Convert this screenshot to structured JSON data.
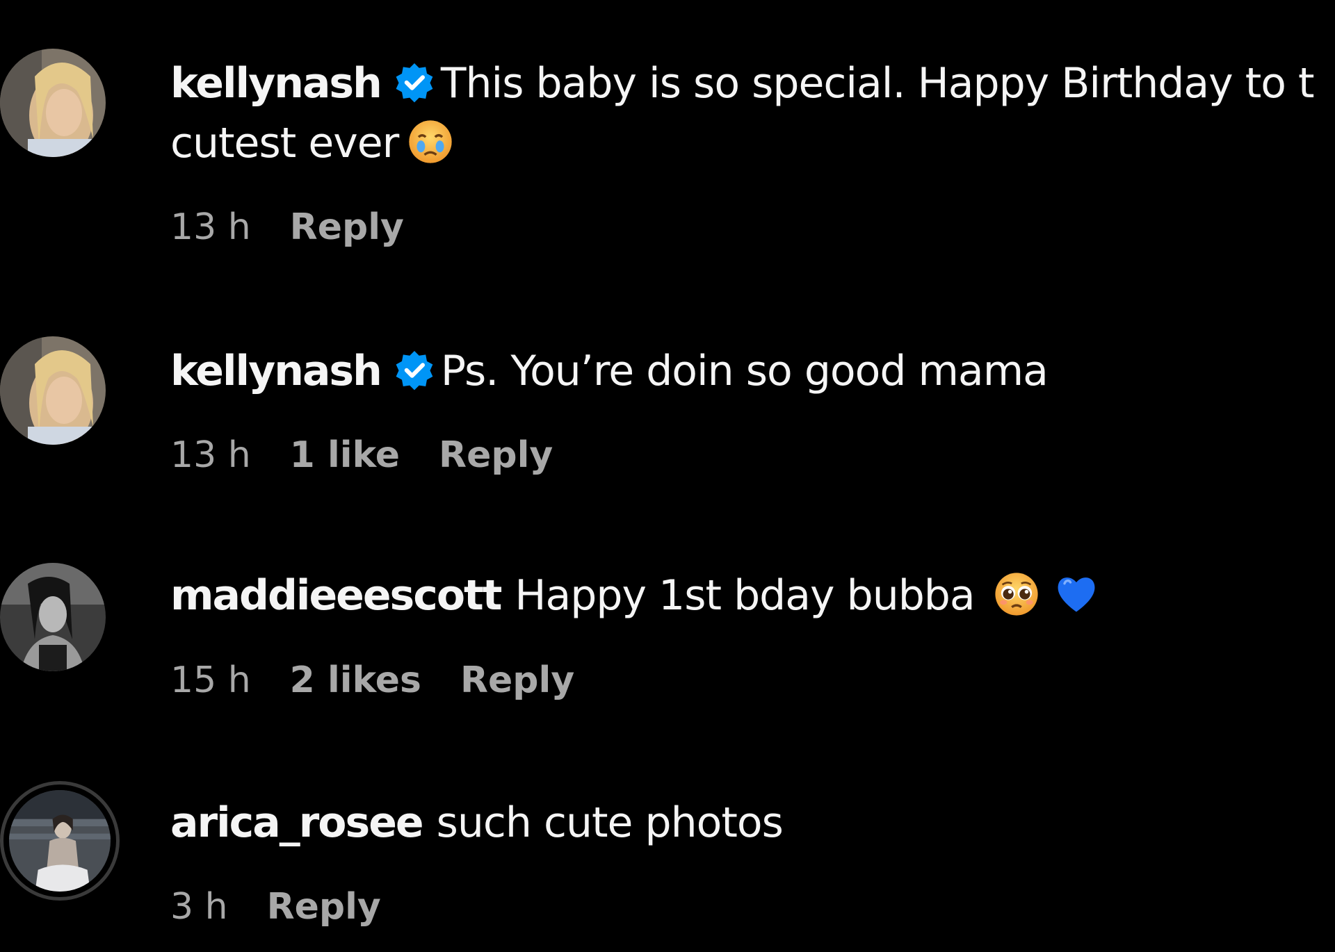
{
  "comments": [
    {
      "username": "kellynash",
      "verified": true,
      "text": "This baby is so special. Happy Birthday to t",
      "text_line2": "cutest ever",
      "emoji": "crying-face-icon",
      "time": "13 h",
      "likes": "",
      "reply_label": "Reply"
    },
    {
      "username": "kellynash",
      "verified": true,
      "text": "Ps. You’re doin so good mama",
      "time": "13 h",
      "likes": "1 like",
      "reply_label": "Reply"
    },
    {
      "username": "maddieeescott",
      "verified": false,
      "text": "Happy 1st bday bubba",
      "emoji": "pleading-face-icon",
      "emoji2": "blue-heart-icon",
      "time": "15 h",
      "likes": "2 likes",
      "reply_label": "Reply"
    },
    {
      "username": "arica_rosee",
      "verified": false,
      "text": "such cute photos",
      "time": "3 h",
      "likes": "",
      "reply_label": "Reply"
    }
  ],
  "colors": {
    "background": "#000000",
    "text": "#f5f5f5",
    "meta": "#a8a8a8",
    "verified_badge": "#0095f6",
    "blue_heart": "#1d6df2"
  }
}
